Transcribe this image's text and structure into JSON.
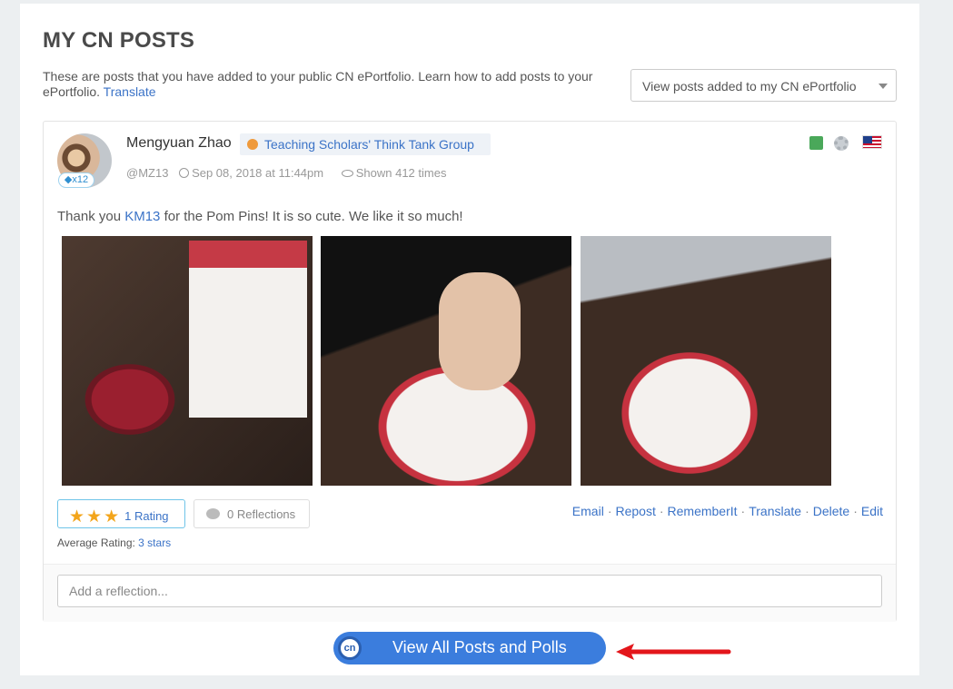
{
  "panel": {
    "title": "MY CN POSTS",
    "intro_text": "These are posts that you have added to your public CN ePortfolio. Learn how to add posts to your ePortfolio. ",
    "intro_link": "Translate",
    "view_select": "View posts added to my CN ePortfolio"
  },
  "post": {
    "author": "Mengyuan Zhao",
    "badge": "x12",
    "group": "Teaching Scholars' Think Tank Group",
    "handle": "@MZ13",
    "date": "Sep 08, 2018 at 11:44pm",
    "views": "Shown 412 times",
    "text_before": "Thank you ",
    "text_link": "KM13",
    "text_after": " for the Pom Pins! It is so cute. We like it so much!",
    "stars": "★★★",
    "rating_label": "1 Rating",
    "reflections_label": "0 Reflections",
    "avg_rating_label": "Average Rating: ",
    "avg_rating_value": "3 stars",
    "actions": {
      "email": "Email",
      "repost": "Repost",
      "rememberit": "RememberIt",
      "translate": "Translate",
      "delete": "Delete",
      "edit": "Edit"
    },
    "reflection_placeholder": "Add a reflection..."
  },
  "footer": {
    "view_all_label": "View All Posts and Polls",
    "cn_icon_text": "cn"
  },
  "colors": {
    "accent": "#3b7ddd",
    "link": "#3b73c7",
    "star": "#f3a51b",
    "arrow": "#e3161b"
  },
  "icons": [
    "diamond-icon",
    "group-icon",
    "clock-icon",
    "eye-icon",
    "lock-icon",
    "gear-icon",
    "us-flag-icon",
    "star-icon",
    "comment-icon",
    "cn-logo-icon",
    "red-arrow-icon"
  ]
}
